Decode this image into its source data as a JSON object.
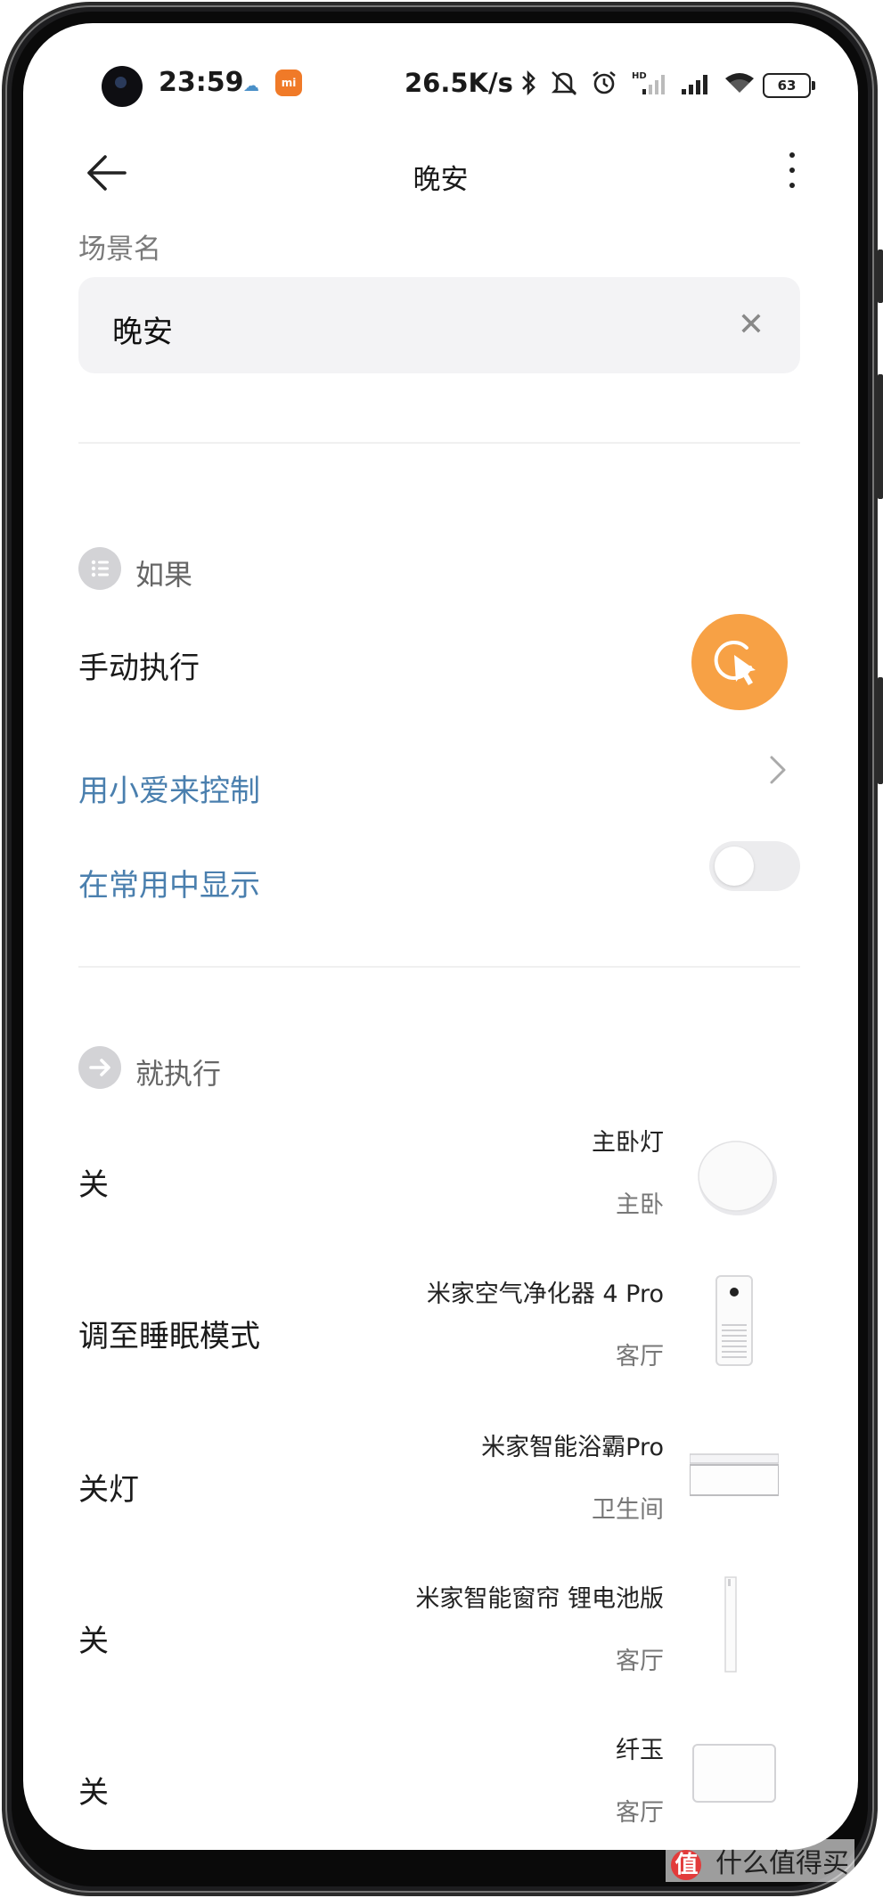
{
  "status_bar": {
    "time": "23:59",
    "network_speed": "26.5K/s",
    "battery": "63",
    "icons": [
      "cloud-icon",
      "mi-app-icon",
      "bluetooth-icon",
      "mute-icon",
      "alarm-icon",
      "hd-signal-icon",
      "signal-icon",
      "wifi-icon",
      "battery-icon"
    ]
  },
  "header": {
    "title": "晚安",
    "back_icon": "back-arrow-icon",
    "more_icon": "more-vertical-icon"
  },
  "scene_name": {
    "label": "场景名",
    "value": "晚安",
    "clear_icon": "clear-icon"
  },
  "if_section": {
    "title": "如果",
    "icon": "list-icon",
    "trigger_label": "手动执行",
    "trigger_icon": "tap-cursor-icon",
    "xiaoai_label": "用小爱来控制",
    "show_common_label": "在常用中显示",
    "show_common_enabled": false
  },
  "then_section": {
    "title": "就执行",
    "icon": "arrow-right-icon",
    "actions": [
      {
        "action": "关",
        "device": "主卧灯",
        "room": "主卧",
        "thumb": "round-light-icon"
      },
      {
        "action": "调至睡眠模式",
        "device": "米家空气净化器 4 Pro",
        "room": "客厅",
        "thumb": "air-purifier-icon"
      },
      {
        "action": "关灯",
        "device": "米家智能浴霸Pro",
        "room": "卫生间",
        "thumb": "bath-heater-icon"
      },
      {
        "action": "关",
        "device": "米家智能窗帘 锂电池版",
        "room": "客厅",
        "thumb": "curtain-icon"
      },
      {
        "action": "关",
        "device": "纤玉",
        "room": "客厅",
        "thumb": "panel-icon"
      }
    ]
  },
  "watermark": {
    "badge": "值",
    "text": "什么值得买"
  }
}
